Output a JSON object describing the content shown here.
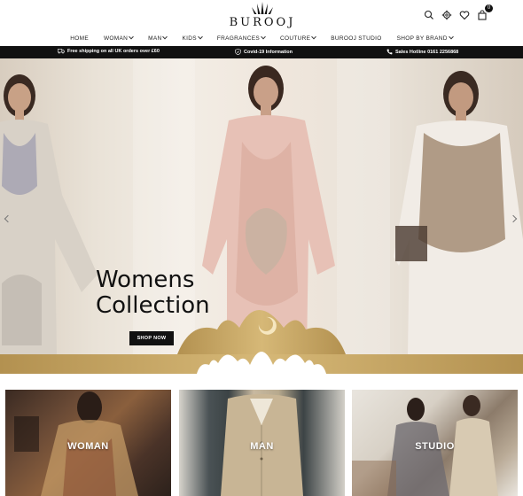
{
  "brand": {
    "name": "BUROOJ"
  },
  "header": {
    "icons": [
      "search-icon",
      "gear-icon",
      "heart-icon",
      "bag-icon"
    ],
    "cart_count": "0"
  },
  "nav": {
    "items": [
      {
        "label": "HOME",
        "dropdown": false
      },
      {
        "label": "WOMAN",
        "dropdown": true
      },
      {
        "label": "MAN",
        "dropdown": true
      },
      {
        "label": "KIDS",
        "dropdown": true
      },
      {
        "label": "FRAGRANCES",
        "dropdown": true
      },
      {
        "label": "COUTURE",
        "dropdown": true
      },
      {
        "label": "BUROOJ STUDIO",
        "dropdown": false
      },
      {
        "label": "SHOP BY BRAND",
        "dropdown": true
      }
    ]
  },
  "announcement": {
    "shipping": "Free shipping on all UK orders over £60",
    "covid": "Covid-19 Information",
    "hotline": "Sales Hotline 0161 2256868"
  },
  "hero": {
    "title_line1": "Womens",
    "title_line2": "Collection",
    "cta": "SHOP NOW"
  },
  "categories": [
    {
      "label": "WOMAN"
    },
    {
      "label": "MAN"
    },
    {
      "label": "STUDIO"
    }
  ],
  "colors": {
    "gold": "#b8913f",
    "gold_light": "#d9bb72",
    "black": "#111111"
  }
}
